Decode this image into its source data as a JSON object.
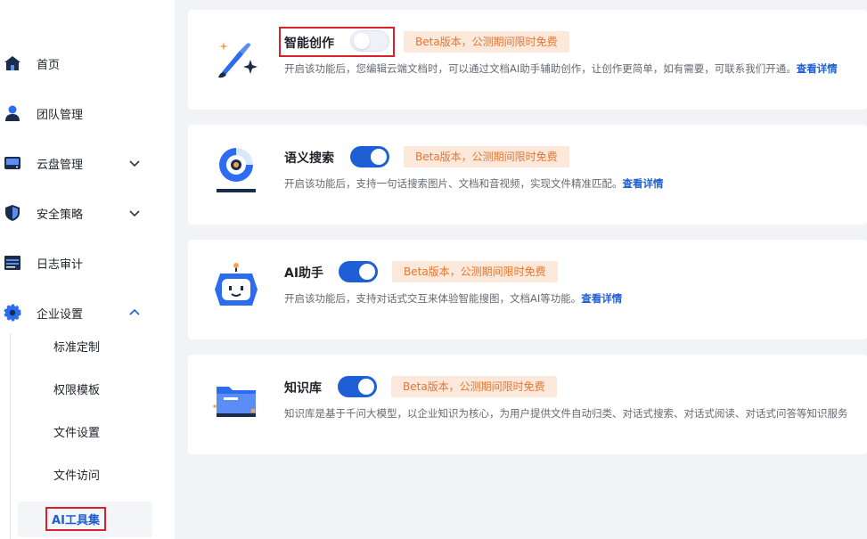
{
  "sidebar": {
    "items": [
      {
        "label": "首页",
        "icon": "home-icon"
      },
      {
        "label": "团队管理",
        "icon": "user-icon"
      },
      {
        "label": "云盘管理",
        "icon": "cloud-disk-icon",
        "chevron": "down"
      },
      {
        "label": "安全策略",
        "icon": "shield-icon",
        "chevron": "down"
      },
      {
        "label": "日志审计",
        "icon": "log-icon"
      },
      {
        "label": "企业设置",
        "icon": "gear-icon",
        "chevron": "up",
        "expanded": true
      }
    ],
    "sub_items": [
      {
        "label": "标准定制"
      },
      {
        "label": "权限模板"
      },
      {
        "label": "文件设置"
      },
      {
        "label": "文件访问"
      },
      {
        "label": "AI工具集",
        "active": true
      }
    ]
  },
  "features": [
    {
      "title": "智能创作",
      "enabled": false,
      "badge": "Beta版本，公测期间限时免费",
      "description": "开启该功能后，您编辑云端文档时，可以通过文档AI助手辅助创作，让创作更简单，如有需要，可联系我们开通。",
      "link": "查看详情",
      "icon": "paintbrush-sparkle-icon"
    },
    {
      "title": "语义搜索",
      "enabled": true,
      "badge": "Beta版本，公测期间限时免费",
      "description": "开启该功能后，支持一句话搜索图片、文档和音视频，实现文件精准匹配。",
      "link": "查看详情",
      "icon": "semantic-search-icon"
    },
    {
      "title": "AI助手",
      "enabled": true,
      "badge": "Beta版本，公测期间限时免费",
      "description": "开启该功能后，支持对话式交互来体验智能搜图，文档AI等功能。",
      "link": "查看详情",
      "icon": "robot-icon"
    },
    {
      "title": "知识库",
      "enabled": true,
      "badge": "Beta版本，公测期间限时免费",
      "description": "知识库是基于千问大模型，以企业知识为核心，为用户提供文件自动归类、对话式搜索、对话式阅读、对话式问答等知识服务",
      "icon": "knowledge-folder-icon"
    }
  ],
  "colors": {
    "primary": "#1f5fd6",
    "badge_bg": "#fde8dc",
    "badge_text": "#e9752b",
    "highlight_border": "#d9212b"
  }
}
